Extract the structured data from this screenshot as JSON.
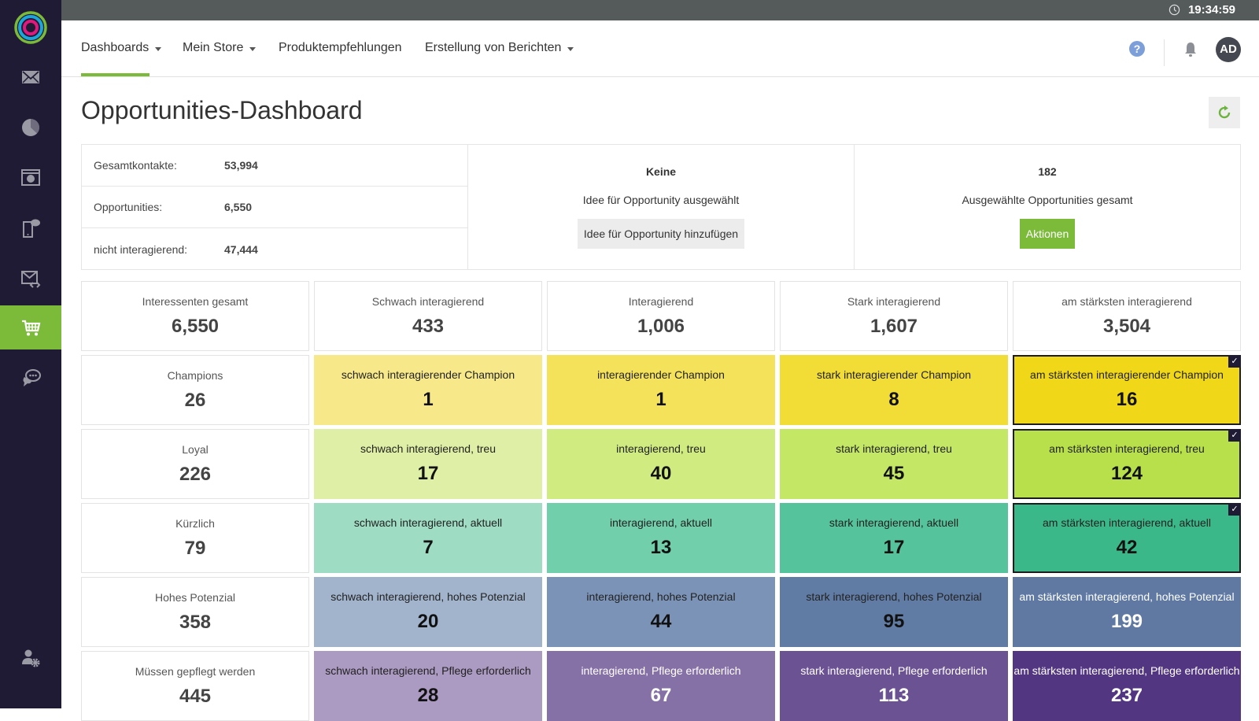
{
  "topbar": {
    "time": "19:34:59"
  },
  "sidebar": {
    "items": [
      {
        "name": "email",
        "icon": "envelope-icon"
      },
      {
        "name": "analytics",
        "icon": "pie-chart-icon"
      },
      {
        "name": "web-analytics",
        "icon": "browser-chart-icon"
      },
      {
        "name": "mobile",
        "icon": "mobile-chat-icon"
      },
      {
        "name": "email-code",
        "icon": "envelope-code-icon"
      },
      {
        "name": "commerce",
        "icon": "cart-icon",
        "active": true
      },
      {
        "name": "chat",
        "icon": "chat-bubbles-icon"
      },
      {
        "name": "user-settings",
        "icon": "user-gear-icon"
      }
    ]
  },
  "nav": {
    "items": [
      {
        "label": "Dashboards",
        "dropdown": true,
        "active": true
      },
      {
        "label": "Mein Store",
        "dropdown": true
      },
      {
        "label": "Produktempfehlungen",
        "dropdown": false
      },
      {
        "label": "Erstellung von Berichten",
        "dropdown": true
      }
    ],
    "help": "?",
    "avatar": "AD"
  },
  "page": {
    "title": "Opportunities-Dashboard"
  },
  "summary": {
    "stats": [
      {
        "label": "Gesamtkontakte:",
        "value": "53,994"
      },
      {
        "label": "Opportunities:",
        "value": "6,550"
      },
      {
        "label": "nicht interagierend:",
        "value": "47,444"
      }
    ],
    "idea": {
      "value": "Keine",
      "desc": "Idee für Opportunity ausgewählt",
      "button": "Idee für Opportunity hinzufügen"
    },
    "selected": {
      "value": "182",
      "desc": "Ausgewählte Opportunities gesamt",
      "button": "Aktionen"
    }
  },
  "grid": {
    "columns": [
      {
        "label": "Interessenten gesamt",
        "value": "6,550"
      },
      {
        "label": "Schwach interagierend",
        "value": "433"
      },
      {
        "label": "Interagierend",
        "value": "1,006"
      },
      {
        "label": "Stark interagierend",
        "value": "1,607"
      },
      {
        "label": "am stärksten interagierend",
        "value": "3,504"
      }
    ],
    "rows": [
      {
        "label": "Champions",
        "value": "26",
        "cells": [
          {
            "label": "schwach interagierender Champion",
            "value": "1",
            "color": "#f7e98a"
          },
          {
            "label": "interagierender Champion",
            "value": "1",
            "color": "#f4e25a"
          },
          {
            "label": "stark interagierender Champion",
            "value": "8",
            "color": "#f2dc36"
          },
          {
            "label": "am stärksten interagierender Champion",
            "value": "16",
            "color": "#f0d818",
            "selected": true
          }
        ]
      },
      {
        "label": "Loyal",
        "value": "226",
        "cells": [
          {
            "label": "schwach interagierend, treu",
            "value": "17",
            "color": "#dfefa5"
          },
          {
            "label": "interagierend, treu",
            "value": "40",
            "color": "#d0eb80"
          },
          {
            "label": "stark interagierend, treu",
            "value": "45",
            "color": "#c4e766"
          },
          {
            "label": "am stärksten interagierend, treu",
            "value": "124",
            "color": "#b8e04a",
            "selected": true
          }
        ]
      },
      {
        "label": "Kürzlich",
        "value": "79",
        "cells": [
          {
            "label": "schwach interagierend, aktuell",
            "value": "7",
            "color": "#9edcc4"
          },
          {
            "label": "interagierend, aktuell",
            "value": "13",
            "color": "#72cfac"
          },
          {
            "label": "stark interagierend, aktuell",
            "value": "17",
            "color": "#55c39b"
          },
          {
            "label": "am stärksten interagierend, aktuell",
            "value": "42",
            "color": "#3bb88a",
            "selected": true
          }
        ]
      },
      {
        "label": "Hohes Potenzial",
        "value": "358",
        "cells": [
          {
            "label": "schwach interagierend, hohes Potenzial",
            "value": "20",
            "color": "#a1b4cc"
          },
          {
            "label": "interagierend, hohes Potenzial",
            "value": "44",
            "color": "#7b93b6"
          },
          {
            "label": "stark interagierend, hohes Potenzial",
            "value": "95",
            "color": "#617ca4"
          },
          {
            "label": "am stärksten interagierend, hohes Potenzial",
            "value": "199",
            "color": "#5f79a2",
            "light": true
          }
        ]
      },
      {
        "label": "Müssen gepflegt werden",
        "value": "445",
        "cells": [
          {
            "label": "schwach interagierend, Pflege erforderlich",
            "value": "28",
            "color": "#ab9ac1",
            "light": false
          },
          {
            "label": "interagierend, Pflege erforderlich",
            "value": "67",
            "color": "#8671a6",
            "light": true
          },
          {
            "label": "stark interagierend, Pflege erforderlich",
            "value": "113",
            "color": "#6b5292",
            "light": true
          },
          {
            "label": "am stärksten interagierend, Pflege erforderlich",
            "value": "237",
            "color": "#523681",
            "light": true
          }
        ]
      }
    ]
  },
  "colors": {
    "accent": "#7cbb3a",
    "sidebar": "#201b35",
    "topbar": "#555a5a",
    "help": "#7d9fd9"
  }
}
